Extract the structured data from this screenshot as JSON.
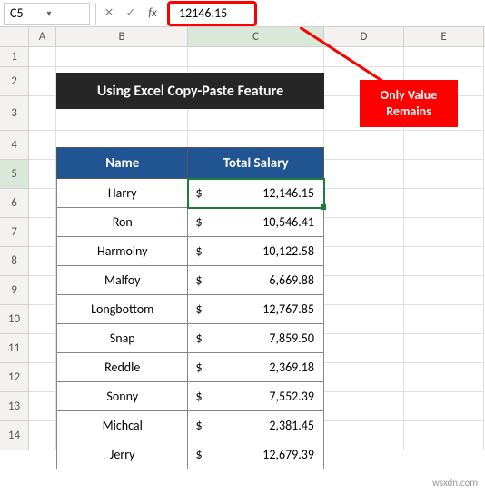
{
  "formula_bar": {
    "name_box": "C5",
    "value": "12146.15"
  },
  "columns": [
    "A",
    "B",
    "C",
    "D",
    "E"
  ],
  "row_numbers": [
    1,
    2,
    3,
    4,
    5,
    6,
    7,
    8,
    9,
    10,
    11,
    12,
    13,
    14
  ],
  "title": "Using Excel Copy-Paste Feature",
  "table": {
    "headers": {
      "name": "Name",
      "salary": "Total Salary"
    },
    "rows": [
      {
        "name": "Harry",
        "currency": "$",
        "salary": "12,146.15"
      },
      {
        "name": "Ron",
        "currency": "$",
        "salary": "10,546.41"
      },
      {
        "name": "Harmoiny",
        "currency": "$",
        "salary": "10,122.58"
      },
      {
        "name": "Malfoy",
        "currency": "$",
        "salary": "6,669.88"
      },
      {
        "name": "Longbottom",
        "currency": "$",
        "salary": "12,767.85"
      },
      {
        "name": "Snap",
        "currency": "$",
        "salary": "7,859.50"
      },
      {
        "name": "Reddle",
        "currency": "$",
        "salary": "2,369.18"
      },
      {
        "name": "Sonny",
        "currency": "$",
        "salary": "7,552.39"
      },
      {
        "name": "Michcal",
        "currency": "$",
        "salary": "2,381.45"
      },
      {
        "name": "Jerry",
        "currency": "$",
        "salary": "12,679.39"
      }
    ]
  },
  "callout": "Only Value Remains",
  "active_cell": {
    "row": 0,
    "col": "salary"
  },
  "watermark": "wsxdn.com"
}
